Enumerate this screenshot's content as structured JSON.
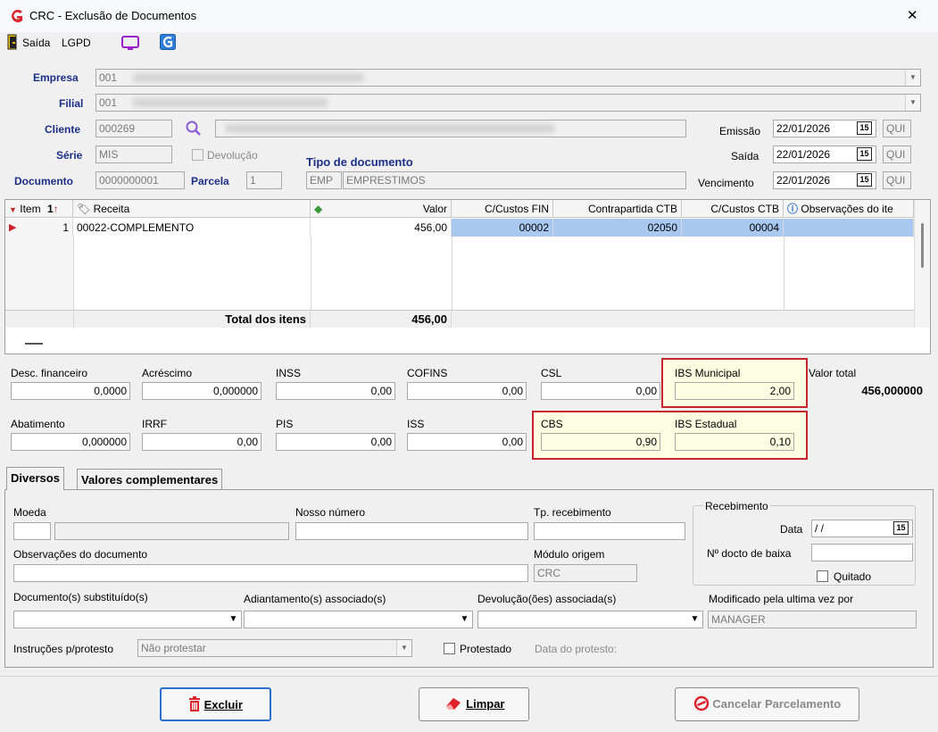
{
  "window": {
    "title": "CRC - Exclusão de Documentos",
    "close": "✕"
  },
  "toolbar": {
    "saida": "Saída",
    "lgpd": "LGPD"
  },
  "header": {
    "empresa_label": "Empresa",
    "empresa_value": "001",
    "filial_label": "Filial",
    "filial_value": "001",
    "cliente_label": "Cliente",
    "cliente_value": "000269",
    "serie_label": "Série",
    "serie_value": "MIS",
    "devolucao_label": "Devolução",
    "documento_label": "Documento",
    "documento_value": "0000000001",
    "parcela_label": "Parcela",
    "parcela_value": "1",
    "tipo_label": "Tipo de documento",
    "tipo_code": "EMP",
    "tipo_value": "EMPRESTIMOS",
    "emissao_label": "Emissão",
    "emissao_value": "22/01/2026",
    "emissao_day": "QUI",
    "saida_label": "Saída",
    "saida_value": "22/01/2026",
    "saida_day": "QUI",
    "vencimento_label": "Vencimento",
    "vencimento_value": "22/01/2026",
    "vencimento_day": "QUI",
    "cal_glyph": "15"
  },
  "grid": {
    "columns": [
      "Item",
      "Receita",
      "Valor",
      "C/Custos FIN",
      "Contrapartida CTB",
      "C/Custos CTB",
      "Observações do ite"
    ],
    "sort_indicator": "1",
    "row": {
      "item": "1",
      "receita": "00022-COMPLEMENTO",
      "valor": "456,00",
      "ccfin": "00002",
      "contrapartida": "02050",
      "ccctb": "00004",
      "obs": ""
    },
    "total_label": "Total dos itens",
    "total_value": "456,00"
  },
  "totals": {
    "desc_fin_label": "Desc. financeiro",
    "desc_fin": "0,0000",
    "acrescimo_label": "Acréscimo",
    "acrescimo": "0,000000",
    "inss_label": "INSS",
    "inss": "0,00",
    "cofins_label": "COFINS",
    "cofins": "0,00",
    "csl_label": "CSL",
    "csl": "0,00",
    "ibs_mun_label": "IBS Municipal",
    "ibs_mun": "2,00",
    "valor_total_label": "Valor total",
    "valor_total": "456,000000",
    "abatimento_label": "Abatimento",
    "abatimento": "0,000000",
    "irrf_label": "IRRF",
    "irrf": "0,00",
    "pis_label": "PIS",
    "pis": "0,00",
    "iss_label": "ISS",
    "iss": "0,00",
    "cbs_label": "CBS",
    "cbs": "0,90",
    "ibs_est_label": "IBS Estadual",
    "ibs_est": "0,10"
  },
  "tabs": {
    "diversos": "Diversos",
    "valores": "Valores complementares"
  },
  "diversos": {
    "moeda_label": "Moeda",
    "nosso_label": "Nosso número",
    "tp_receb_label": "Tp. recebimento",
    "receb_group": "Recebimento",
    "data_label": "Data",
    "data_value": " / /",
    "ndocto_label": "Nº docto de baixa",
    "quitado_label": "Quitado",
    "obs_doc_label": "Observações do documento",
    "modulo_label": "Módulo origem",
    "modulo_value": "CRC",
    "doc_subst_label": "Documento(s) substituído(s)",
    "adiant_label": "Adiantamento(s) associado(s)",
    "devol_label": "Devolução(ões) associada(s)",
    "modificado_label": "Modificado pela ultima vez por",
    "modificado_value": "MANAGER",
    "instr_label": "Instruções p/protesto",
    "instr_value": "Não protestar",
    "protestado_label": "Protestado",
    "data_protesto_label": "Data do protesto:"
  },
  "buttons": {
    "excluir": "Excluir",
    "limpar": "Limpar",
    "cancelar": "Cancelar Parcelamento"
  },
  "colors": {
    "accent_red": "#c7252b",
    "label_blue": "#1c2f87",
    "highlight_yellow": "#fefee2",
    "selection_blue": "#a8c8f0"
  }
}
